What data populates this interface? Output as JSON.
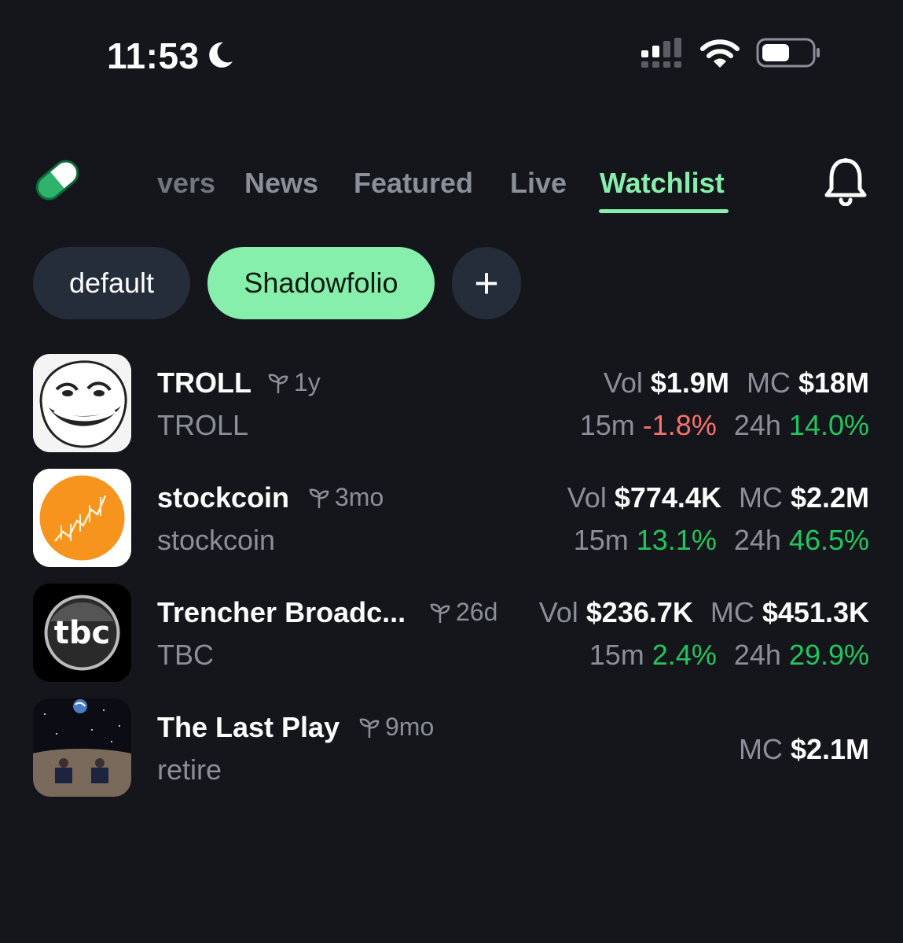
{
  "status_bar": {
    "time": "11:53"
  },
  "nav": {
    "tabs": [
      {
        "label": "vers",
        "active": false
      },
      {
        "label": "News",
        "active": false
      },
      {
        "label": "Featured",
        "active": false
      },
      {
        "label": "Live",
        "active": false
      },
      {
        "label": "Watchlist",
        "active": true
      }
    ]
  },
  "watchlists": {
    "chips": [
      "default",
      "Shadowfolio"
    ],
    "add_label": "+"
  },
  "tokens": [
    {
      "name": "TROLL",
      "age": "1y",
      "symbol": "TROLL",
      "vol_label": "Vol",
      "vol": "$1.9M",
      "mc_label": "MC",
      "mc": "$18M",
      "m15_label": "15m",
      "m15": "-1.8%",
      "h24_label": "24h",
      "h24": "14.0%"
    },
    {
      "name": "stockcoin",
      "age": "3mo",
      "symbol": "stockcoin",
      "vol_label": "Vol",
      "vol": "$774.4K",
      "mc_label": "MC",
      "mc": "$2.2M",
      "m15_label": "15m",
      "m15": "13.1%",
      "h24_label": "24h",
      "h24": "46.5%"
    },
    {
      "name": "Trencher Broadc...",
      "age": "26d",
      "symbol": "TBC",
      "vol_label": "Vol",
      "vol": "$236.7K",
      "mc_label": "MC",
      "mc": "$451.3K",
      "m15_label": "15m",
      "m15": "2.4%",
      "h24_label": "24h",
      "h24": "29.9%"
    },
    {
      "name": "The Last Play",
      "age": "9mo",
      "symbol": "retire",
      "mc_label": "MC",
      "mc": "$2.1M"
    }
  ],
  "colors": {
    "accent": "#86efac",
    "positive": "#22c55e",
    "negative": "#f87171",
    "background": "#15161b"
  },
  "icons": [
    "moon-icon",
    "signal-icon",
    "wifi-icon",
    "battery-icon",
    "pill-logo-icon",
    "bell-icon",
    "sprout-icon",
    "plus-icon"
  ]
}
